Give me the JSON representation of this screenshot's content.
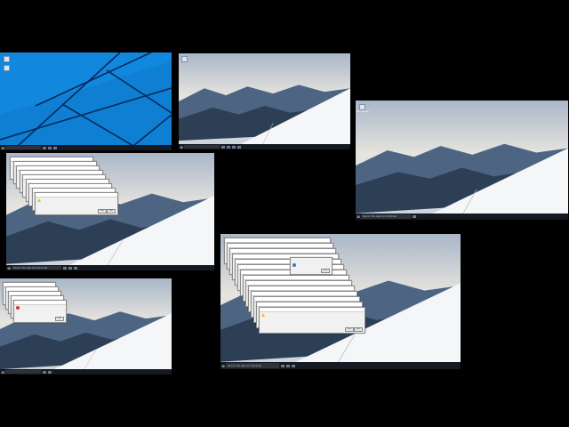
{
  "screens": [
    {
      "id": "blue-desktop",
      "wallpaper": "windows-10-blue",
      "wallpaper_color": "#1a8fe0",
      "desktop_icons": [
        {
          "icon": "recycle-bin-icon",
          "label": ""
        },
        {
          "icon": "user-folder-icon",
          "label": ""
        }
      ],
      "taskbar": {
        "search_placeholder": "",
        "tray_lines": [
          "",
          ""
        ]
      }
    },
    {
      "id": "mountain-desktop-1",
      "wallpaper": "snowy-mountain",
      "desktop_icons": [
        {
          "icon": "recycle-bin-icon",
          "label": ""
        }
      ],
      "taskbar": {
        "search_placeholder": "",
        "tray_lines": [
          "",
          ""
        ]
      }
    },
    {
      "id": "mountain-desktop-2",
      "wallpaper": "snowy-mountain",
      "desktop_icons": [
        {
          "icon": "recycle-bin-icon",
          "label": "Recycle Bin"
        }
      ],
      "taskbar": {
        "search_placeholder": "Search the web and Windows",
        "tray_lines": [
          "",
          ""
        ]
      }
    },
    {
      "id": "warning-cascade",
      "wallpaper": "snowy-mountain",
      "dialog_stack": {
        "count": 9,
        "icon": "warning-icon",
        "title": "",
        "message": "",
        "question": "",
        "buttons": [
          "Yes",
          "No"
        ]
      },
      "taskbar": {
        "search_placeholder": "Search the web and Windows",
        "tray_lines": [
          "",
          ""
        ]
      }
    },
    {
      "id": "error-cascade",
      "wallpaper": "snowy-mountain",
      "dialog_stack": {
        "count": 5,
        "icon": "error-icon",
        "title": "",
        "message": "",
        "buttons": [
          "OK"
        ]
      },
      "taskbar": {
        "search_placeholder": "",
        "tray_lines": [
          "",
          ""
        ]
      }
    },
    {
      "id": "mixed-cascade",
      "wallpaper": "snowy-mountain",
      "dialog_stack": {
        "count": 14,
        "icon": "warning-icon",
        "title": "",
        "message": "",
        "question": "",
        "buttons": [
          "Yes",
          "No"
        ],
        "top_dialog": {
          "icon": "info-icon",
          "message": "",
          "buttons": [
            "OK"
          ]
        }
      },
      "watermark": [
        "",
        "",
        ""
      ],
      "taskbar": {
        "search_placeholder": "Search the web and Windows",
        "tray_lines": [
          "",
          ""
        ]
      }
    }
  ]
}
